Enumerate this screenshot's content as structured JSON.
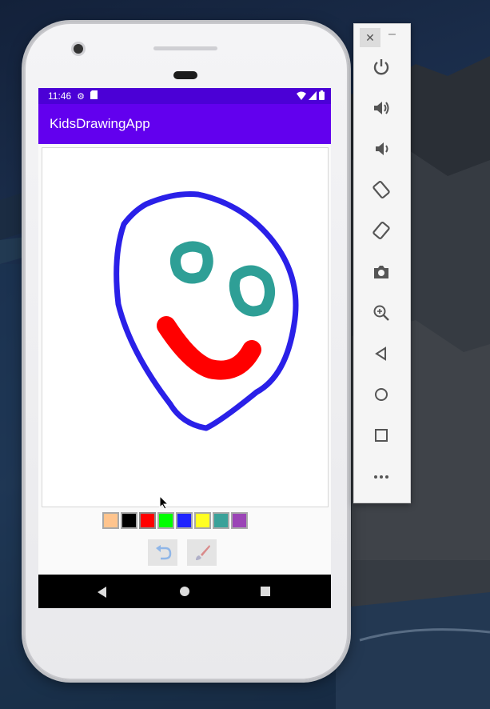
{
  "status_bar": {
    "time": "11:46"
  },
  "app": {
    "title": "KidsDrawingApp"
  },
  "palette": {
    "colors": [
      "#ffc48d",
      "#000000",
      "#ff0000",
      "#00ff00",
      "#1f24ff",
      "#ffff22",
      "#3aa199",
      "#9b45b6"
    ],
    "selected_index": 2
  },
  "tools": [
    {
      "name": "undo"
    },
    {
      "name": "brush"
    }
  ],
  "drawing": {
    "face_color": "#2a20e8",
    "eye_color": "#2e9f96",
    "mouth_color": "#ff0000"
  },
  "emulator_panel": {
    "close_label": "✕",
    "minimize_label": "–",
    "buttons": [
      "power",
      "volume-up",
      "volume-down",
      "rotate-left",
      "rotate-right",
      "screenshot",
      "zoom",
      "back",
      "home",
      "overview",
      "more"
    ]
  }
}
